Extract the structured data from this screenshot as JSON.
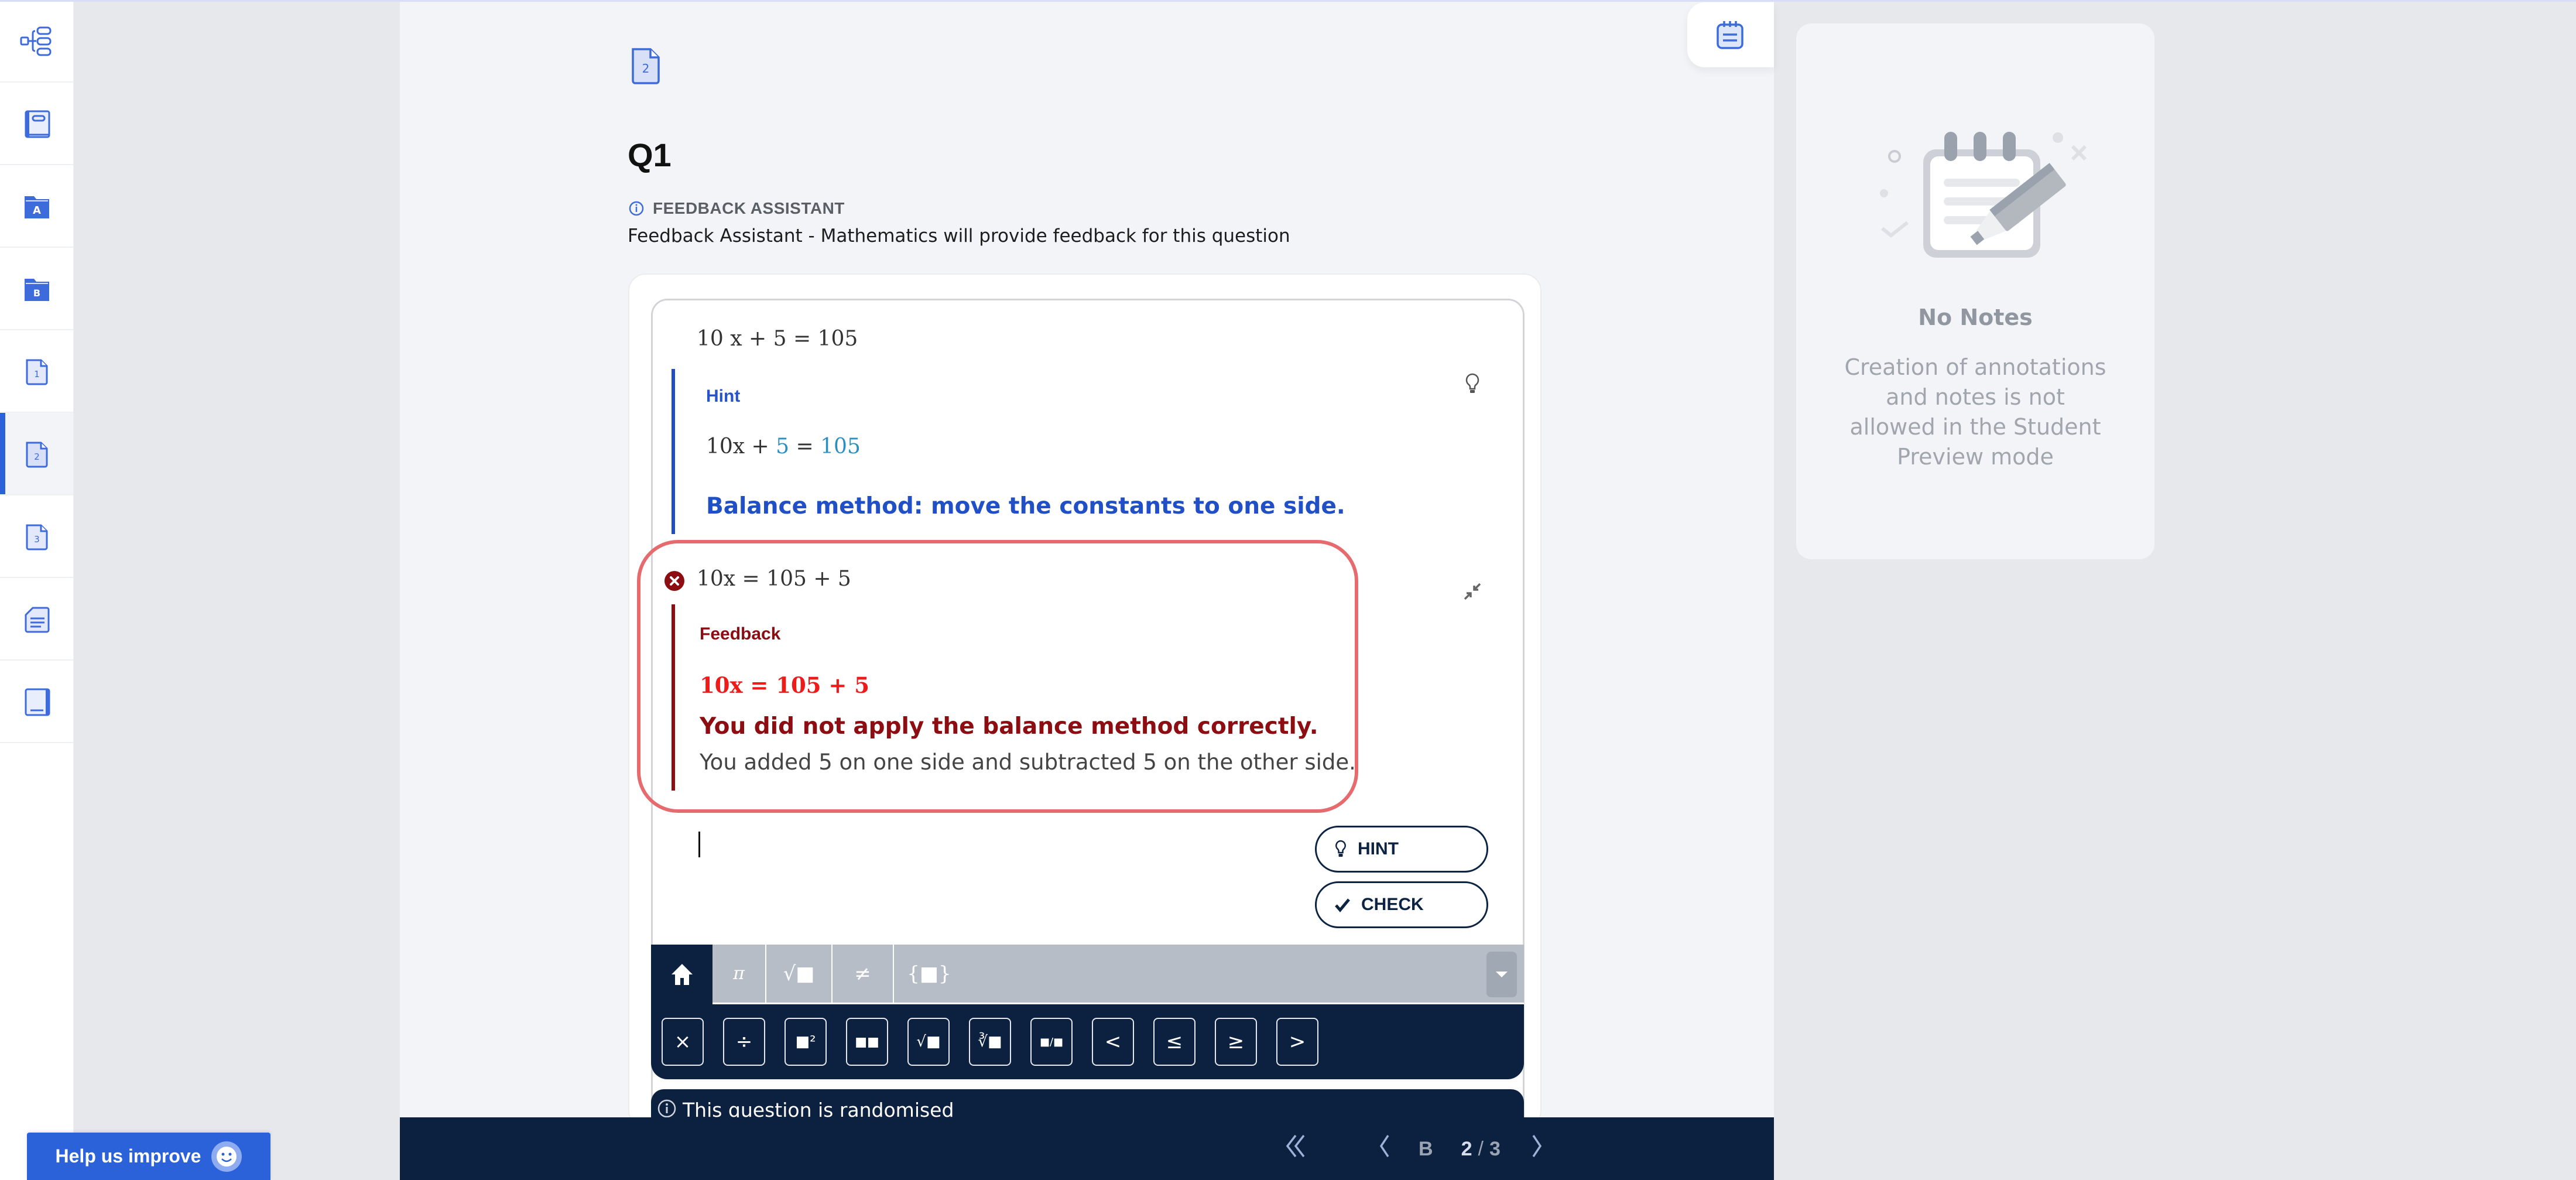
{
  "sidebar": {
    "items": [
      {
        "icon": "tree-structure-icon",
        "label": "",
        "active": false
      },
      {
        "icon": "book-icon",
        "label": "",
        "active": false
      },
      {
        "icon": "folder-a-icon",
        "label": "A",
        "active": false
      },
      {
        "icon": "folder-b-icon",
        "label": "B",
        "active": false
      },
      {
        "icon": "page-1-icon",
        "label": "1",
        "active": false
      },
      {
        "icon": "page-2-icon",
        "label": "2",
        "active": true
      },
      {
        "icon": "page-3-icon",
        "label": "3",
        "active": false
      },
      {
        "icon": "document-lines-icon",
        "label": "",
        "active": false
      },
      {
        "icon": "notebook-icon",
        "label": "",
        "active": false
      }
    ]
  },
  "question": {
    "page_number": "2",
    "title": "Q1",
    "assistant_label": "FEEDBACK ASSISTANT",
    "assistant_description": "Feedback Assistant - Mathematics will provide feedback for this question",
    "equation": "10 x  + 5 = 105"
  },
  "hint": {
    "title": "Hint",
    "equation_parts": [
      "10x + ",
      "5",
      " = ",
      "105"
    ],
    "text": "Balance method: move the constants to one side."
  },
  "feedback": {
    "attempt": "10x = 105 + 5",
    "title": "Feedback",
    "equation": "10x = 105 + 5",
    "message": "You did not apply the balance method correctly.",
    "detail": "You added 5 on one side and subtracted 5 on the other side.",
    "status": "incorrect"
  },
  "answer": {
    "value": "",
    "placeholder": ""
  },
  "buttons": {
    "hint": "HINT",
    "check": "CHECK"
  },
  "keypad": {
    "tabs": [
      "π",
      "√■",
      "≠",
      "{■}"
    ],
    "keys": [
      "×",
      "÷",
      "■²",
      "■■",
      "√■",
      "∛■",
      "■/■",
      "<",
      "≤",
      "≥",
      ">"
    ]
  },
  "randomised_notice": "This question is randomised",
  "pagination": {
    "section": "B",
    "current": "2",
    "separator": "/",
    "total": "3"
  },
  "notes": {
    "title": "No Notes",
    "description": "Creation of annotations and notes is not allowed in the Student Preview mode"
  },
  "help": {
    "label": "Help us improve"
  },
  "colors": {
    "accent": "#2b62d9",
    "navy": "#0c2140",
    "hint_blue": "#2150c6",
    "feedback_red": "#8c0d12",
    "error_border": "#e56b6e"
  }
}
